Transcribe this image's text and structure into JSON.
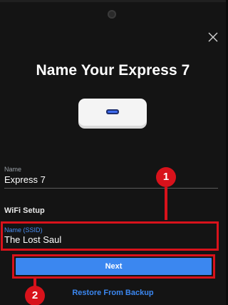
{
  "modal": {
    "title": "Name Your Express 7",
    "device_name_label": "Name",
    "device_name_value": "Express 7",
    "wifi_section_title": "WiFi Setup",
    "ssid_label": "Name (SSID)",
    "ssid_value": "The Lost Saul",
    "next_label": "Next",
    "restore_label": "Restore From Backup"
  },
  "annotations": {
    "step1": "1",
    "step2": "2"
  },
  "icons": {
    "close": "close-icon",
    "device": "express-device-icon",
    "camera": "camera-icon"
  },
  "colors": {
    "accent": "#3b87f0",
    "annotation_red": "#d8121b",
    "background": "#141414"
  }
}
